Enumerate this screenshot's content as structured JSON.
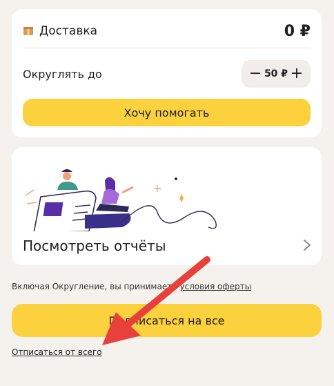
{
  "delivery": {
    "label": "Доставка",
    "price": "0 ₽"
  },
  "rounding": {
    "label": "Округлять до",
    "minus": "−",
    "value": "50 ₽",
    "plus": "+"
  },
  "help_button": "Хочу помогать",
  "reports": {
    "label": "Посмотреть отчёты"
  },
  "offer": {
    "prefix": "Включая Округление, вы принимаете ",
    "link": "условия оферты"
  },
  "subscribe_button": "Подписаться на все",
  "unsubscribe_link": "Отписаться от всего",
  "colors": {
    "accent": "#fbd13d",
    "background": "#f5f2ed",
    "arrow": "#e8403a"
  },
  "icons": {
    "delivery": "box-icon",
    "reports": "chevron-right-icon"
  }
}
